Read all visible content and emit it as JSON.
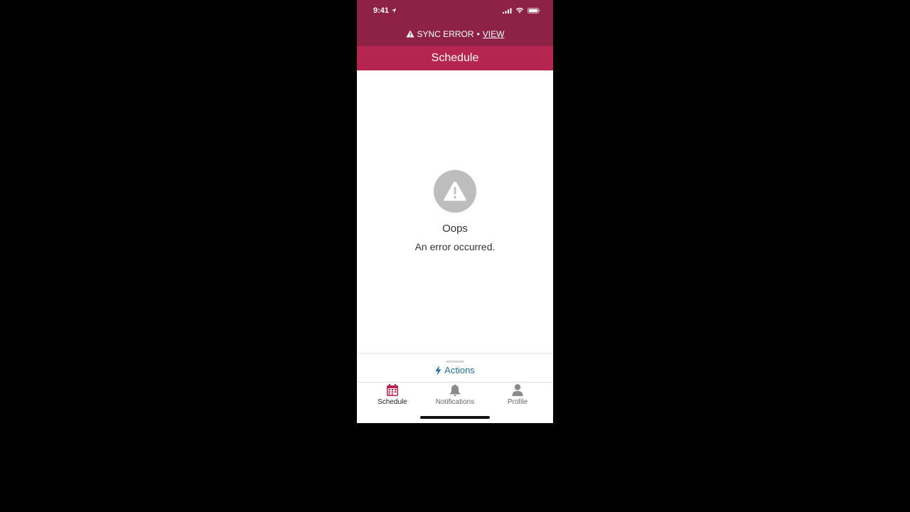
{
  "status_bar": {
    "time": "9:41"
  },
  "sync_banner": {
    "text": "SYNC ERROR",
    "separator": "•",
    "link": "VIEW"
  },
  "header": {
    "title": "Schedule"
  },
  "error": {
    "title": "Oops",
    "message": "An error occurred."
  },
  "actions": {
    "label": "Actions"
  },
  "tabs": [
    {
      "label": "Schedule",
      "icon": "calendar-icon",
      "active": true
    },
    {
      "label": "Notifications",
      "icon": "bell-icon",
      "active": false
    },
    {
      "label": "Profile",
      "icon": "person-icon",
      "active": false
    }
  ],
  "colors": {
    "primary_dark": "#8e2146",
    "primary": "#b5254f",
    "link_blue": "#1f6fa8",
    "error_icon_gray": "#bdbdbd",
    "active_tab": "#b5254f",
    "inactive_tab": "#8a8a8a"
  }
}
